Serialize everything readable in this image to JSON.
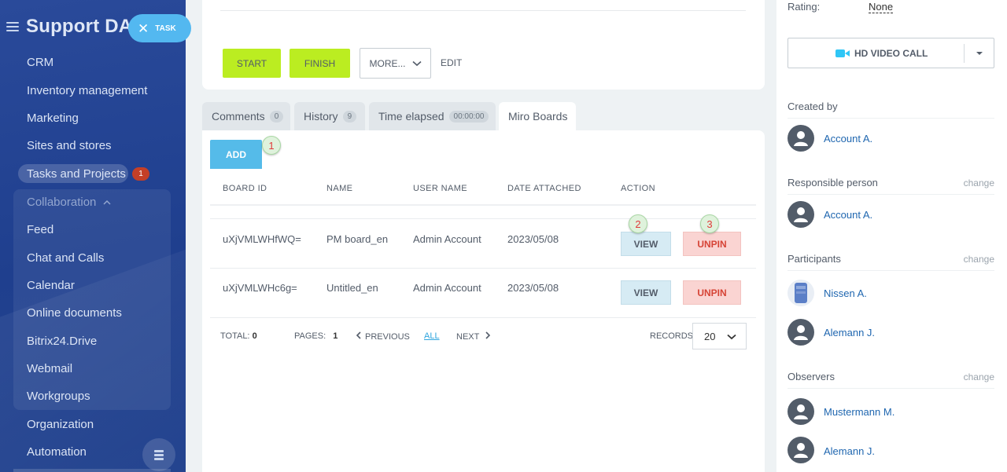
{
  "sidebar": {
    "logo": "Support DAG",
    "task_button": "TASK",
    "items": [
      {
        "label": "CRM"
      },
      {
        "label": "Inventory management"
      },
      {
        "label": "Marketing"
      },
      {
        "label": "Sites and stores"
      },
      {
        "label": "Tasks and Projects",
        "badge": "1"
      },
      {
        "label": "Collaboration"
      },
      {
        "label": "Feed"
      },
      {
        "label": "Chat and Calls"
      },
      {
        "label": "Calendar"
      },
      {
        "label": "Online documents"
      },
      {
        "label": "Bitrix24.Drive"
      },
      {
        "label": "Webmail"
      },
      {
        "label": "Workgroups"
      },
      {
        "label": "Organization"
      },
      {
        "label": "Automation"
      }
    ]
  },
  "toolbar": {
    "start": "START",
    "finish": "FINISH",
    "more": "MORE...",
    "edit": "EDIT"
  },
  "tabs": [
    {
      "label": "Comments",
      "count": "0"
    },
    {
      "label": "History",
      "count": "9"
    },
    {
      "label": "Time elapsed",
      "count": "00:00:00"
    },
    {
      "label": "Miro Boards"
    }
  ],
  "boards": {
    "add": "ADD",
    "columns": [
      "BOARD ID",
      "NAME",
      "USER NAME",
      "DATE ATTACHED",
      "ACTION"
    ],
    "rows": [
      {
        "board_id": "uXjVMLWHfWQ=",
        "name": "PM board_en",
        "user": "Admin Account",
        "date": "2023/05/08",
        "view": "VIEW",
        "unpin": "UNPIN"
      },
      {
        "board_id": "uXjVMLWHc6g=",
        "name": "Untitled_en",
        "user": "Admin Account",
        "date": "2023/05/08",
        "view": "VIEW",
        "unpin": "UNPIN"
      }
    ],
    "annotations": [
      "1",
      "2",
      "3"
    ],
    "footer": {
      "total_label": "TOTAL:",
      "total": "0",
      "pages_label": "PAGES:",
      "pages": "1",
      "previous": "PREVIOUS",
      "all": "ALL",
      "next": "NEXT",
      "records_label": "RECORDS:",
      "records": "20"
    }
  },
  "right_panel": {
    "rating_label": "Rating:",
    "rating_value": "None",
    "video_call": "HD VIDEO CALL",
    "created_by": {
      "label": "Created by",
      "people": [
        "Account A."
      ]
    },
    "responsible": {
      "label": "Responsible person",
      "change": "change",
      "people": [
        "Account A."
      ]
    },
    "participants": {
      "label": "Participants",
      "change": "change",
      "people": [
        "Nissen A.",
        "Alemann J."
      ]
    },
    "observers": {
      "label": "Observers",
      "change": "change",
      "people": [
        "Mustermann M.",
        "Alemann J."
      ]
    }
  },
  "colors": {
    "sidebar_bg": "#1f3f8e",
    "accent_green": "#bbed21",
    "accent_blue": "#55bbe9",
    "unpin_red": "#d64436",
    "link_blue": "#2067b0"
  }
}
